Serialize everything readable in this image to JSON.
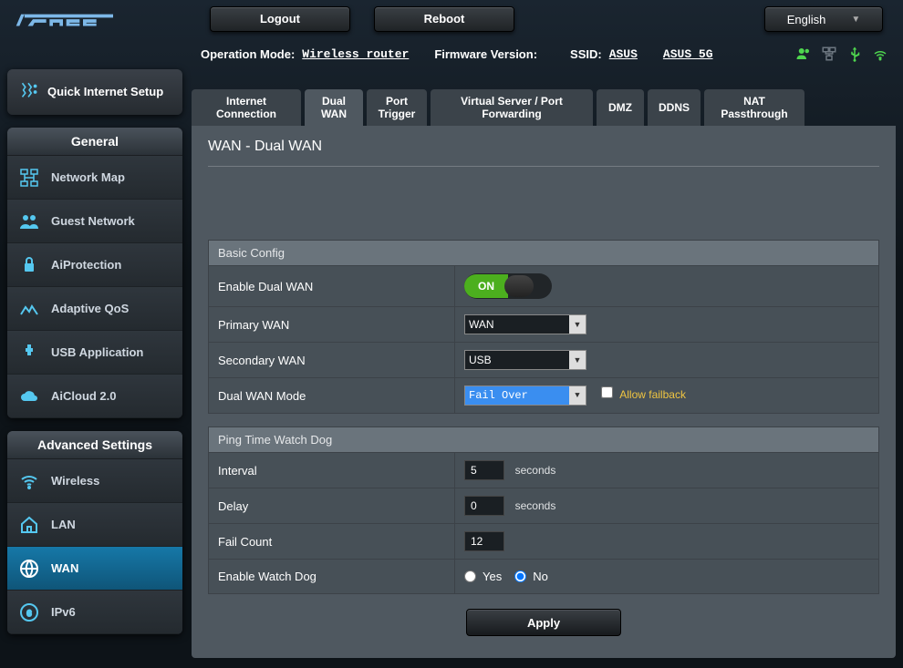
{
  "header": {
    "logout": "Logout",
    "reboot": "Reboot",
    "language": "English"
  },
  "status": {
    "opmode_label": "Operation Mode:",
    "opmode_value": "Wireless router",
    "fw_label": "Firmware Version:",
    "ssid_label": "SSID:",
    "ssid1": "ASUS",
    "ssid2": "ASUS_5G"
  },
  "qis": {
    "label": "Quick Internet Setup"
  },
  "nav": {
    "general_head": "General",
    "advanced_head": "Advanced Settings",
    "general": {
      "network_map": "Network Map",
      "guest_network": "Guest Network",
      "aiprotection": "AiProtection",
      "adaptive_qos": "Adaptive QoS",
      "usb_app": "USB Application",
      "aicloud": "AiCloud 2.0"
    },
    "advanced": {
      "wireless": "Wireless",
      "lan": "LAN",
      "wan": "WAN",
      "ipv6": "IPv6"
    }
  },
  "tabs": {
    "internet": "Internet Connection",
    "dualwan": "Dual WAN",
    "port_trigger": "Port Trigger",
    "vsf": "Virtual Server / Port Forwarding",
    "dmz": "DMZ",
    "ddns": "DDNS",
    "nat": "NAT Passthrough"
  },
  "panel": {
    "title": "WAN - Dual WAN",
    "basic_head": "Basic Config",
    "enable_dual": "Enable Dual WAN",
    "toggle_on": "ON",
    "primary_wan": "Primary WAN",
    "primary_wan_val": "WAN",
    "secondary_wan": "Secondary WAN",
    "secondary_wan_val": "USB",
    "dual_mode": "Dual WAN Mode",
    "dual_mode_val": "Fail Over",
    "allow_failback": "Allow failback",
    "ping_head": "Ping Time Watch Dog",
    "interval": "Interval",
    "interval_val": "5",
    "seconds": "seconds",
    "delay": "Delay",
    "delay_val": "0",
    "fail_count": "Fail Count",
    "fail_count_val": "12",
    "enable_wd": "Enable Watch Dog",
    "yes": "Yes",
    "no": "No",
    "apply": "Apply"
  }
}
